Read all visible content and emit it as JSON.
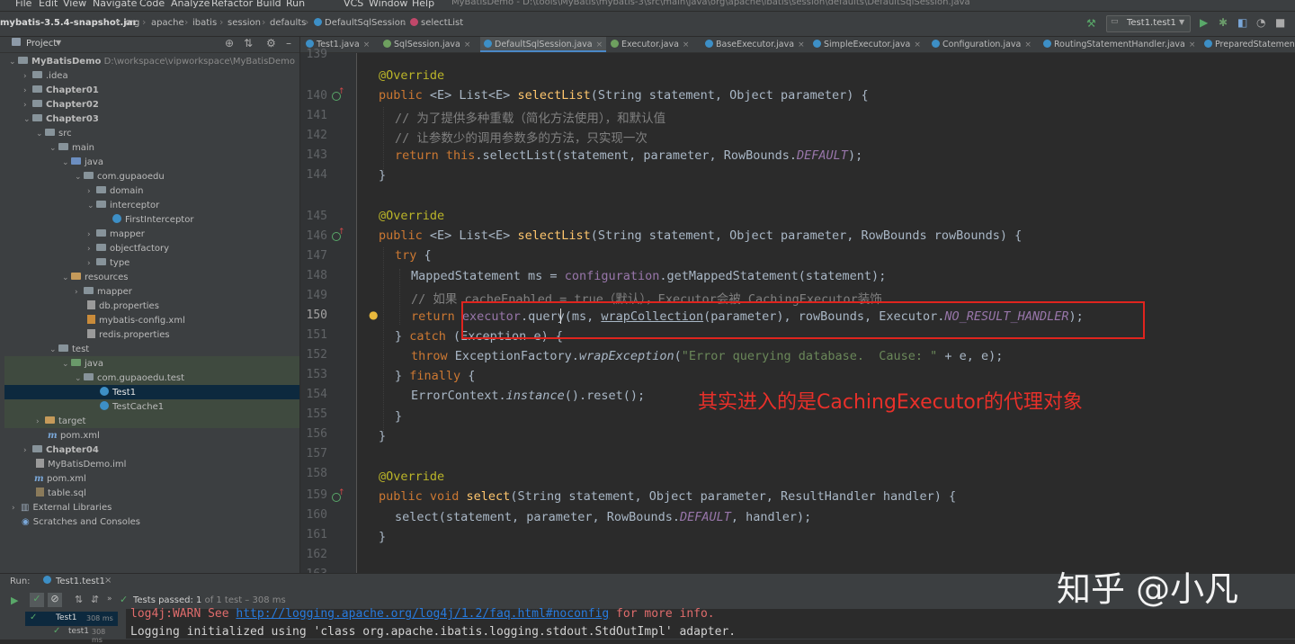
{
  "menu": {
    "items": [
      "File",
      "Edit",
      "View",
      "Navigate",
      "Code",
      "Analyze",
      "Refactor",
      "Build",
      "Run",
      "VCS",
      "Window",
      "Help"
    ],
    "window_title": "MyBatisDemo - D:\\tools\\MyBatis\\mybatis-3\\src\\main\\java\\org\\apache\\ibatis\\session\\defaults\\DefaultSqlSession.java"
  },
  "navbar": {
    "crumbs": [
      "mybatis-3.5.4-snapshot.jar",
      "org",
      "apache",
      "ibatis",
      "session",
      "defaults",
      "DefaultSqlSession",
      "selectList"
    ],
    "run_config": "Test1.test1"
  },
  "project": {
    "title": "Project",
    "tree": [
      {
        "label": "MyBatisDemo",
        "extra": "D:\\workspace\\vipworkspace\\MyBatisDemo"
      },
      {
        "label": ".idea"
      },
      {
        "label": "Chapter01"
      },
      {
        "label": "Chapter02"
      },
      {
        "label": "Chapter03"
      },
      {
        "label": "src"
      },
      {
        "label": "main"
      },
      {
        "label": "java"
      },
      {
        "label": "com.gupaoedu"
      },
      {
        "label": "domain"
      },
      {
        "label": "interceptor"
      },
      {
        "label": "FirstInterceptor"
      },
      {
        "label": "mapper"
      },
      {
        "label": "objectfactory"
      },
      {
        "label": "type"
      },
      {
        "label": "resources"
      },
      {
        "label": "mapper"
      },
      {
        "label": "db.properties"
      },
      {
        "label": "mybatis-config.xml"
      },
      {
        "label": "redis.properties"
      },
      {
        "label": "test"
      },
      {
        "label": "java"
      },
      {
        "label": "com.gupaoedu.test"
      },
      {
        "label": "Test1"
      },
      {
        "label": "TestCache1"
      },
      {
        "label": "target"
      },
      {
        "label": "pom.xml"
      },
      {
        "label": "Chapter04"
      },
      {
        "label": "MyBatisDemo.iml"
      },
      {
        "label": "pom.xml"
      },
      {
        "label": "table.sql"
      },
      {
        "label": "External Libraries"
      },
      {
        "label": "Scratches and Consoles"
      }
    ]
  },
  "tabs": [
    "Test1.java",
    "SqlSession.java",
    "DefaultSqlSession.java",
    "Executor.java",
    "BaseExecutor.java",
    "SimpleExecutor.java",
    "Configuration.java",
    "RoutingStatementHandler.java",
    "PreparedStatementHandler.java"
  ],
  "editor": {
    "line_numbers": [
      "139",
      "140",
      "141",
      "142",
      "143",
      "144",
      "145",
      "146",
      "147",
      "148",
      "149",
      "150",
      "151",
      "152",
      "153",
      "154",
      "155",
      "156",
      "157",
      "158",
      "159",
      "160",
      "161",
      "162",
      "163"
    ],
    "annotation": "其实进入的是CachingExecutor的代理对象",
    "code": {
      "l139_ann": "@Override",
      "l140_kw": "public",
      "l140_a": " <E> List<E> ",
      "l140_fn": "selectList",
      "l140_b": "(String statement, Object parameter) {",
      "l141": "// 为了提供多种重载（简化方法使用），和默认值",
      "l142": "// 让参数少的调用参数多的方法，只实现一次",
      "l143_kw": "return this",
      "l143_a": ".selectList(statement, parameter, RowBounds.",
      "l143_f": "DEFAULT",
      "l143_b": ");",
      "l144": "}",
      "l146_ann": "@Override",
      "l147_kw": "public",
      "l147_a": " <E> List<E> ",
      "l147_fn": "selectList",
      "l147_b": "(String statement, Object parameter, RowBounds rowBounds) {",
      "l148_kw": "try",
      "l148_b": " {",
      "l149_a": "MappedStatement ms = ",
      "l149_f": "configuration",
      "l149_b": ".getMappedStatement(statement);",
      "l150": "// 如果 cacheEnabled = true（默认），Executor会被 CachingExecutor装饰",
      "l151_kw": "return",
      "l151_f": " executor",
      "l151_a": ".query(ms, ",
      "l151_l": "wrapCollection",
      "l151_b": "(parameter), rowBounds, Executor.",
      "l151_c": "NO_RESULT_HANDLER",
      "l151_d": ");",
      "l152_a": "} ",
      "l152_kw": "catch",
      "l152_b": " (Exception e) {",
      "l153_kw": "throw",
      "l153_a": " ExceptionFactory.",
      "l153_i": "wrapException",
      "l153_s": "\"Error querying database.  Cause: \"",
      "l153_b": " + e, e);",
      "l154_a": "} ",
      "l154_kw": "finally",
      "l154_b": " {",
      "l155_a": "ErrorContext.",
      "l155_i": "instance",
      "l155_b": "().reset();",
      "l156": "}",
      "l157": "}",
      "l159_ann": "@Override",
      "l160_kw": "public void",
      "l160_fn": " select",
      "l160_b": "(String statement, Object parameter, ResultHandler handler) {",
      "l161_a": "select(statement, parameter, RowBounds.",
      "l161_f": "DEFAULT",
      "l161_b": ", handler);",
      "l162": "}"
    }
  },
  "watermark": "知乎 @小凡",
  "run": {
    "label": "Run:",
    "config": "Test1.test1",
    "status_bold": "Tests passed: 1",
    "status_rest": " of 1 test – 308 ms",
    "test_item": "Test1",
    "test_time": "308 ms",
    "test_sub": "test1",
    "test_sub_time": "308 ms",
    "console_line1_a": "log4j:WARN See ",
    "console_line1_link": "http://logging.apache.org/log4j/1.2/faq.html#noconfig",
    "console_line1_b": " for more info.",
    "console_line2": "Logging initialized using 'class org.apache.ibatis.logging.stdout.StdOutImpl' adapter."
  }
}
